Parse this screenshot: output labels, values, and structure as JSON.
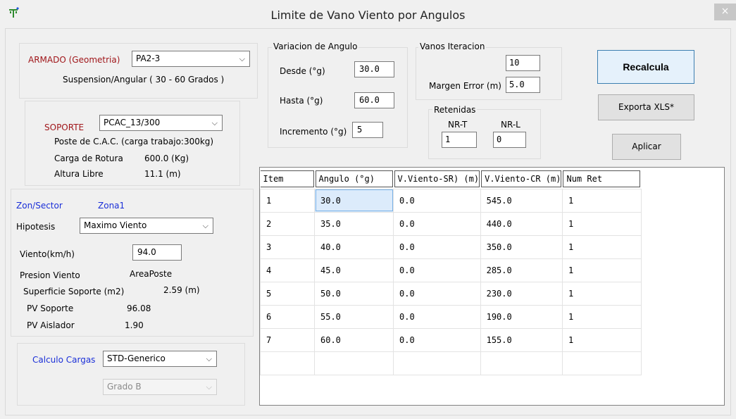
{
  "window": {
    "title": "Limite de Vano Viento por Angulos",
    "close": "×"
  },
  "armado": {
    "label": "ARMADO (Geometria)",
    "value": "PA2-3",
    "desc": "Suspension/Angular ( 30 - 60 Grados )"
  },
  "soporte": {
    "label": "SOPORTE",
    "value": "PCAC_13/300",
    "desc": "Poste de C.A.C. (carga trabajo:300kg)",
    "carga_label": "Carga de Rotura",
    "carga_value": "600.0 (Kg)",
    "altura_label": "Altura Libre",
    "altura_value": "11.1 (m)"
  },
  "zona": {
    "label": "Zon/Sector",
    "value": "Zona1",
    "hipotesis_label": "Hipotesis",
    "hipotesis_value": "Maximo Viento",
    "viento_label": "Viento(km/h)",
    "viento_value": "94.0",
    "presion_label": "Presion Viento",
    "presion_value": "AreaPoste",
    "superficie_label": "Superficie Soporte (m2)",
    "superficie_value": "2.59 (m)",
    "pv_soporte_label": "PV Soporte",
    "pv_soporte_value": "96.08",
    "pv_aislador_label": "PV Aislador",
    "pv_aislador_value": "1.90"
  },
  "calculo": {
    "label": "Calculo Cargas",
    "value": "STD-Generico",
    "grado": "Grado B"
  },
  "variacion": {
    "legend": "Variacion de Angulo",
    "desde_label": "Desde (°g)",
    "desde_value": "30.0",
    "hasta_label": "Hasta (°g)",
    "hasta_value": "60.0",
    "incremento_label": "Incremento (°g)",
    "incremento_value": "5"
  },
  "vanos": {
    "legend": "Vanos Iteracion",
    "value": "10",
    "margen_label": "Margen Error (m)",
    "margen_value": "5.0"
  },
  "retenidas": {
    "legend": "Retenidas",
    "nrt_label": "NR-T",
    "nrt_value": "1",
    "nrl_label": "NR-L",
    "nrl_value": "0"
  },
  "buttons": {
    "recalcula": "Recalcula",
    "exporta": "Exporta XLS*",
    "aplicar": "Aplicar"
  },
  "table": {
    "headers": [
      "Item",
      "Angulo (°g)",
      "V.Viento-SR) (m)",
      "V.Viento-CR (m)",
      "Num Ret"
    ],
    "rows": [
      [
        "1",
        "30.0",
        "0.0",
        "545.0",
        "1"
      ],
      [
        "2",
        "35.0",
        "0.0",
        "440.0",
        "1"
      ],
      [
        "3",
        "40.0",
        "0.0",
        "350.0",
        "1"
      ],
      [
        "4",
        "45.0",
        "0.0",
        "285.0",
        "1"
      ],
      [
        "5",
        "50.0",
        "0.0",
        "230.0",
        "1"
      ],
      [
        "6",
        "55.0",
        "0.0",
        "190.0",
        "1"
      ],
      [
        "7",
        "60.0",
        "0.0",
        "155.0",
        "1"
      ]
    ]
  }
}
